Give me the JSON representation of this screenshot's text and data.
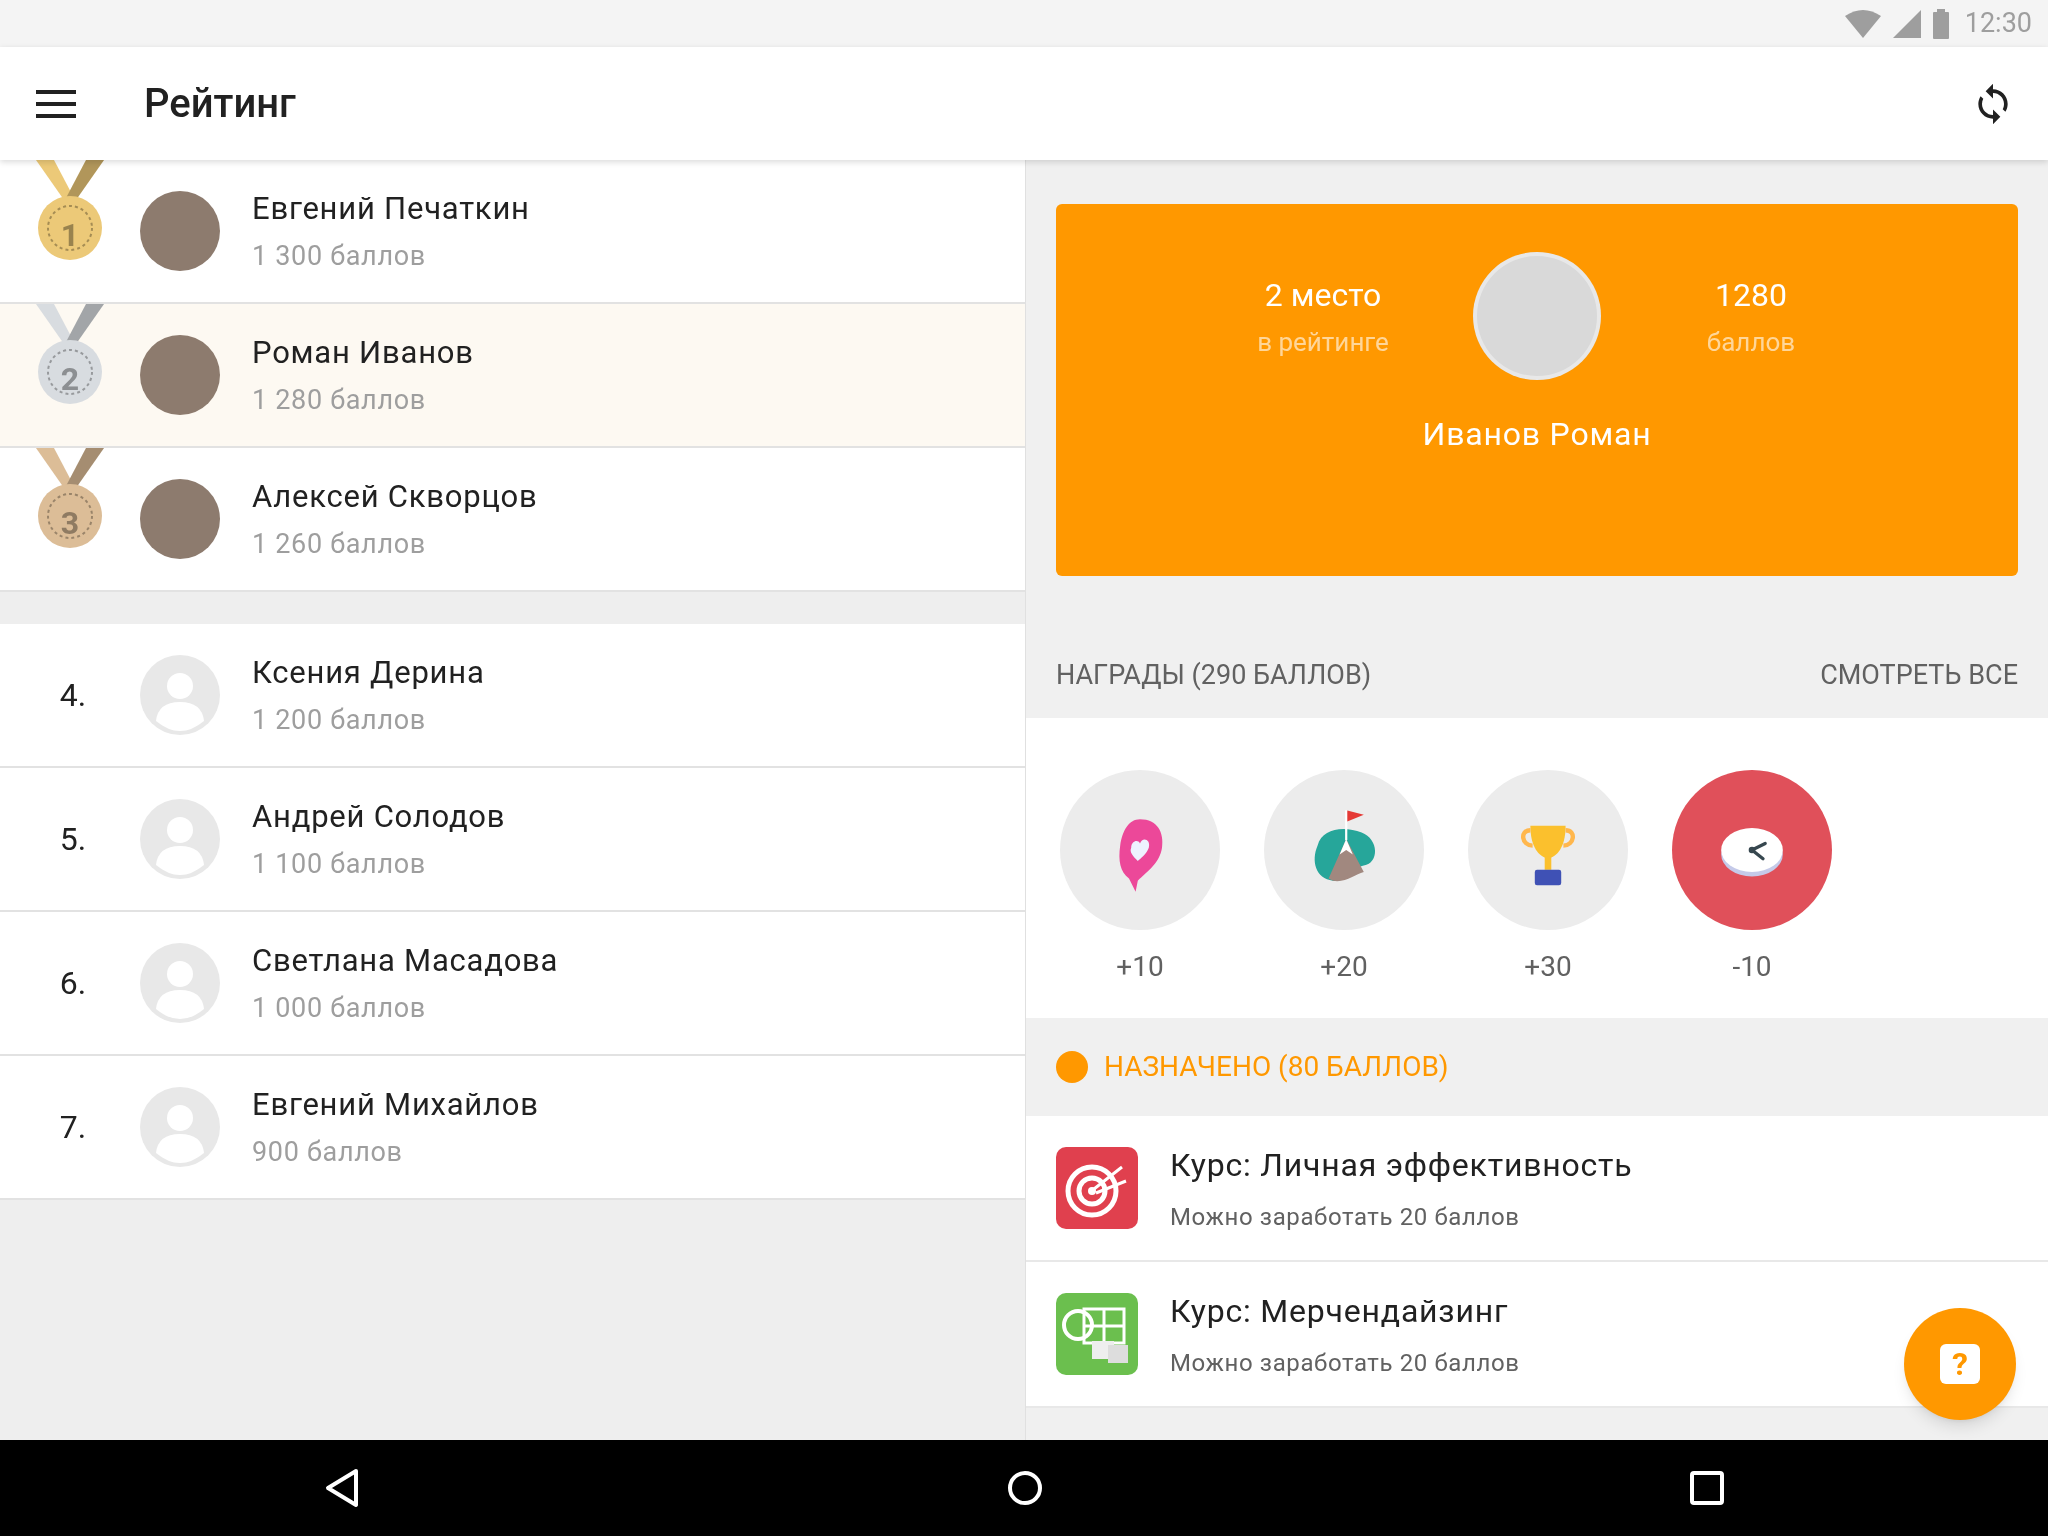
{
  "status_bar": {
    "time": "12:30"
  },
  "toolbar": {
    "title": "Рейтинг"
  },
  "leaders": [
    {
      "kind": "medal",
      "rank": "1",
      "color": "#ecc978",
      "name": "Евгений Печаткин",
      "points": "1 300 баллов",
      "has_photo": true,
      "selected": false
    },
    {
      "kind": "medal",
      "rank": "2",
      "color": "#d8dce0",
      "name": "Роман Иванов",
      "points": "1 280 баллов",
      "has_photo": true,
      "selected": true
    },
    {
      "kind": "medal",
      "rank": "3",
      "color": "#dcbd97",
      "name": "Алексей Скворцов",
      "points": "1 260 баллов",
      "has_photo": true,
      "selected": false
    }
  ],
  "others": [
    {
      "kind": "number",
      "rank": "4.",
      "name": "Ксения Дерина",
      "points": "1 200 баллов",
      "has_photo": false,
      "selected": false
    },
    {
      "kind": "number",
      "rank": "5.",
      "name": "Андрей Солодов",
      "points": "1 100 баллов",
      "has_photo": false,
      "selected": false
    },
    {
      "kind": "number",
      "rank": "6.",
      "name": "Светлана Масадова",
      "points": "1 000 баллов",
      "has_photo": false,
      "selected": false
    },
    {
      "kind": "number",
      "rank": "7.",
      "name": "Евгений Михайлов",
      "points": "900 баллов",
      "has_photo": false,
      "selected": false
    }
  ],
  "profile_card": {
    "place": "2 место",
    "place_caption": "в рейтинге",
    "score": "1280",
    "score_caption": "баллов",
    "name": "Иванов Роман"
  },
  "awards": {
    "title": "НАГРАДЫ (290 БАЛЛОВ)",
    "see_all": "СМОТРЕТЬ ВСЕ",
    "items": [
      {
        "kind": "heart",
        "label": "+10",
        "penalty": false
      },
      {
        "kind": "mountain",
        "label": "+20",
        "penalty": false
      },
      {
        "kind": "trophy",
        "label": "+30",
        "penalty": false
      },
      {
        "kind": "clock",
        "label": "-10",
        "penalty": true
      }
    ]
  },
  "assigned": {
    "title": "НАЗНАЧЕНО (80 БАЛЛОВ)",
    "color": "#ff9800",
    "courses": [
      {
        "kind": "target",
        "title": "Курс: Личная эффективность",
        "subtitle": "Можно заработать 20 баллов"
      },
      {
        "kind": "shelf",
        "title": "Курс: Мерчендайзинг",
        "subtitle": "Можно заработать 20 баллов"
      }
    ]
  },
  "fab": {
    "label": "?"
  }
}
